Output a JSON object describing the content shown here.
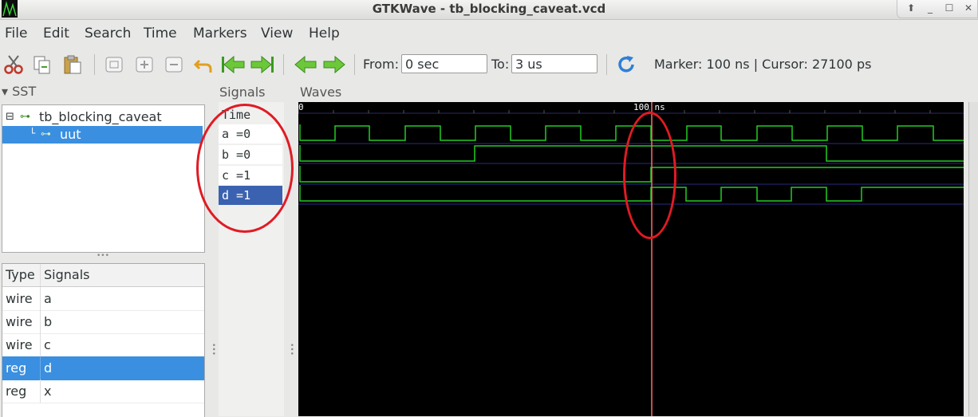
{
  "window": {
    "title": "GTKWave - tb_blocking_caveat.vcd",
    "controls": [
      "⬆",
      "_",
      "☐",
      "✕"
    ]
  },
  "menu": [
    "File",
    "Edit",
    "Search",
    "Time",
    "Markers",
    "View",
    "Help"
  ],
  "toolbar": {
    "icons": [
      "cut-icon",
      "copy-icon",
      "paste-icon",
      "zoom-fit-icon",
      "zoom-in-icon",
      "zoom-out-icon",
      "undo-zoom-icon",
      "zoom-to-start-icon",
      "zoom-to-end-icon",
      "find-prev-edge-icon",
      "find-next-edge-icon",
      "reload-icon"
    ],
    "from_label": "From:",
    "from_value": "0 sec",
    "to_label": "To:",
    "to_value": "3 us",
    "status": "Marker: 100 ns  |  Cursor: 27100 ps"
  },
  "sst": {
    "label": "SST",
    "tree": [
      {
        "label": "tb_blocking_caveat",
        "selected": false
      },
      {
        "label": "uut",
        "selected": true
      }
    ],
    "table_headers": [
      "Type",
      "Signals"
    ],
    "rows": [
      {
        "type": "wire",
        "name": "a",
        "selected": false
      },
      {
        "type": "wire",
        "name": "b",
        "selected": false
      },
      {
        "type": "wire",
        "name": "c",
        "selected": false
      },
      {
        "type": "reg",
        "name": "d",
        "selected": true
      },
      {
        "type": "reg",
        "name": "x",
        "selected": false
      }
    ]
  },
  "signals_panel": {
    "label": "Signals",
    "items": [
      {
        "text": "Time",
        "selected": false
      },
      {
        "text": "a =0",
        "selected": false
      },
      {
        "text": "b =0",
        "selected": false
      },
      {
        "text": "c =1",
        "selected": false
      },
      {
        "text": "d =1",
        "selected": true
      }
    ]
  },
  "waves_panel": {
    "label": "Waves",
    "time_labels": [
      "0",
      "100 ns"
    ],
    "marker_time_ns": 100,
    "colors": {
      "background": "#000000",
      "wave": "#22cc22",
      "marker": "#ff6a6a",
      "annotation": "#e01b24"
    }
  }
}
